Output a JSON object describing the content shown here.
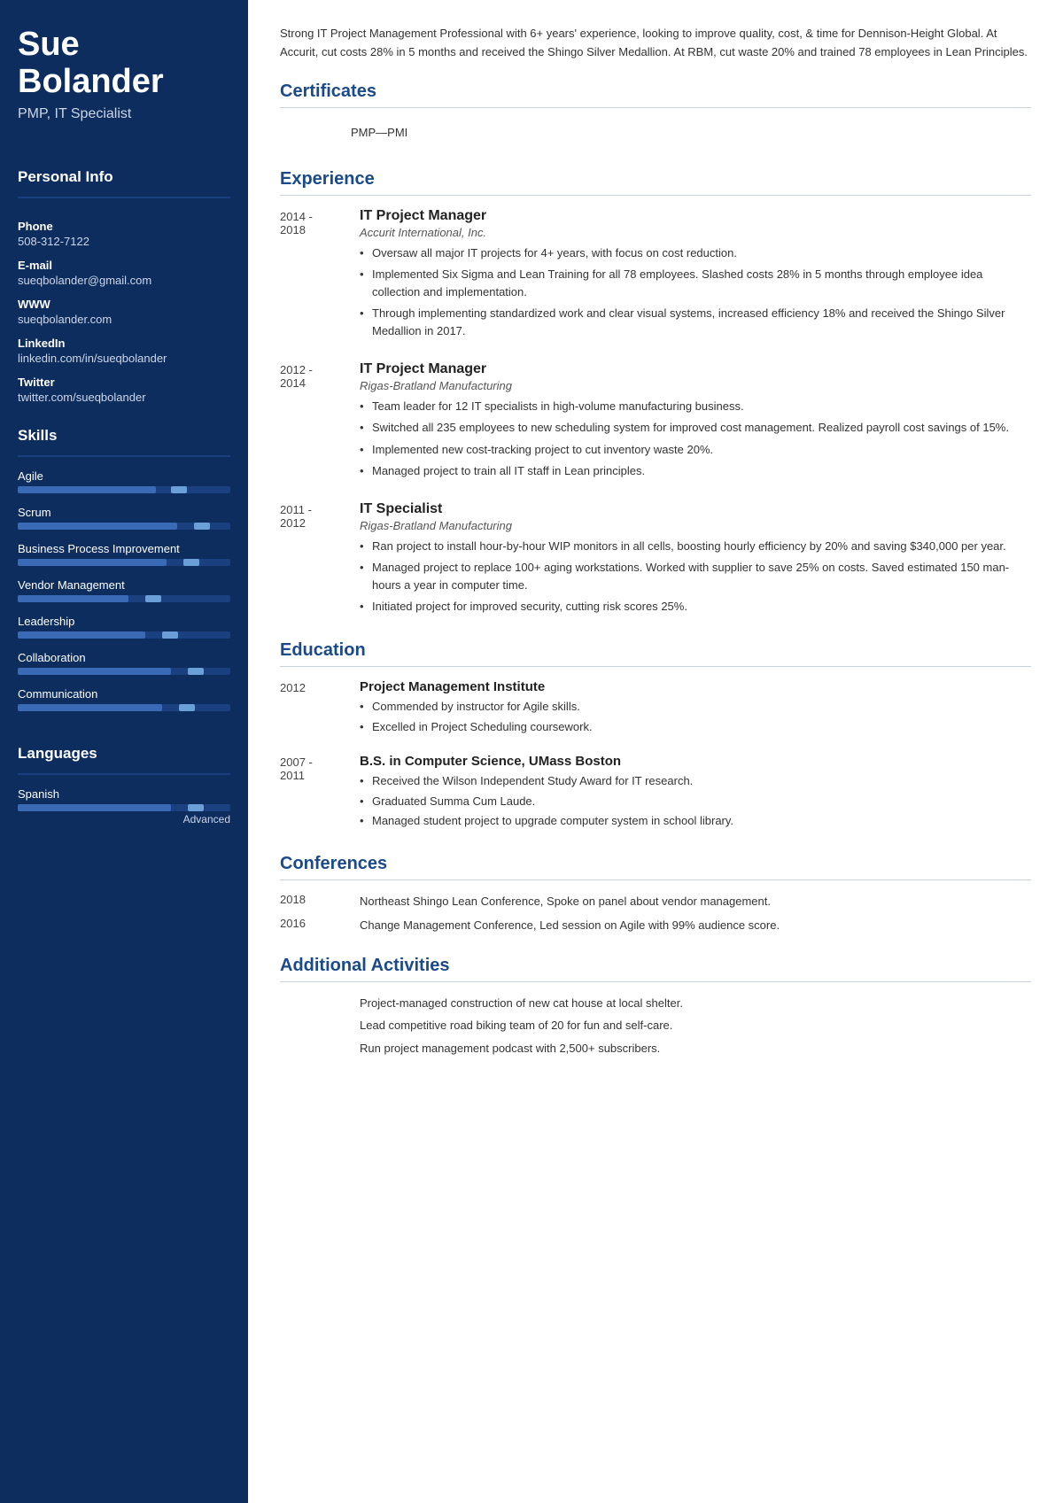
{
  "sidebar": {
    "name": "Sue\nBolander",
    "name_line1": "Sue",
    "name_line2": "Bolander",
    "title": "PMP, IT Specialist",
    "personal_info_label": "Personal Info",
    "phone_label": "Phone",
    "phone": "508-312-7122",
    "email_label": "E-mail",
    "email": "sueqbolander@gmail.com",
    "www_label": "WWW",
    "www": "sueqbolander.com",
    "linkedin_label": "LinkedIn",
    "linkedin": "linkedin.com/in/sueqbolander",
    "twitter_label": "Twitter",
    "twitter": "twitter.com/sueqbolander",
    "skills_label": "Skills",
    "skills": [
      {
        "name": "Agile",
        "fill_pct": 65,
        "dot_pct": 72
      },
      {
        "name": "Scrum",
        "fill_pct": 75,
        "dot_pct": 83
      },
      {
        "name": "Business Process Improvement",
        "fill_pct": 70,
        "dot_pct": 78
      },
      {
        "name": "Vendor Management",
        "fill_pct": 52,
        "dot_pct": 60
      },
      {
        "name": "Leadership",
        "fill_pct": 60,
        "dot_pct": 68
      },
      {
        "name": "Collaboration",
        "fill_pct": 72,
        "dot_pct": 80
      },
      {
        "name": "Communication",
        "fill_pct": 68,
        "dot_pct": 76
      }
    ],
    "languages_label": "Languages",
    "languages": [
      {
        "name": "Spanish",
        "fill_pct": 72,
        "dot_pct": 80,
        "level": "Advanced"
      }
    ]
  },
  "main": {
    "summary": "Strong IT Project Management Professional with 6+ years' experience, looking to improve quality, cost, & time for Dennison-Height Global. At Accurit, cut costs 28% in 5 months and received the Shingo Silver Medallion. At RBM, cut waste 20% and trained 78 employees in Lean Principles.",
    "certificates_label": "Certificates",
    "certificates": [
      {
        "value": "PMP—PMI"
      }
    ],
    "experience_label": "Experience",
    "experience": [
      {
        "dates": "2014 -\n2018",
        "title": "IT Project Manager",
        "company": "Accurit International, Inc.",
        "bullets": [
          "Oversaw all major IT projects for 4+ years, with focus on cost reduction.",
          "Implemented Six Sigma and Lean Training for all 78 employees. Slashed costs 28% in 5 months through employee idea collection and implementation.",
          "Through implementing standardized work and clear visual systems, increased efficiency 18% and received the Shingo Silver Medallion in 2017."
        ]
      },
      {
        "dates": "2012 -\n2014",
        "title": "IT Project Manager",
        "company": "Rigas-Bratland Manufacturing",
        "bullets": [
          "Team leader for 12 IT specialists in high-volume manufacturing business.",
          "Switched all 235 employees to new scheduling system for improved cost management. Realized payroll cost savings of 15%.",
          "Implemented new cost-tracking project to cut inventory waste 20%.",
          "Managed project to train all IT staff in Lean principles."
        ]
      },
      {
        "dates": "2011 -\n2012",
        "title": "IT Specialist",
        "company": "Rigas-Bratland Manufacturing",
        "bullets": [
          "Ran project to install hour-by-hour WIP monitors in all cells, boosting hourly efficiency by 20% and saving $340,000 per year.",
          "Managed project to replace 100+ aging workstations. Worked with supplier to save 25% on costs. Saved estimated 150 man-hours a year in computer time.",
          "Initiated project for improved security, cutting risk scores 25%."
        ]
      }
    ],
    "education_label": "Education",
    "education": [
      {
        "dates": "2012",
        "title": "Project Management Institute",
        "bullets": [
          "Commended by instructor for Agile skills.",
          "Excelled in Project Scheduling coursework."
        ]
      },
      {
        "dates": "2007 -\n2011",
        "title": "B.S. in Computer Science, UMass Boston",
        "bullets": [
          "Received the Wilson Independent Study Award for IT research.",
          "Graduated Summa Cum Laude.",
          "Managed student project to upgrade computer system in school library."
        ]
      }
    ],
    "conferences_label": "Conferences",
    "conferences": [
      {
        "year": "2018",
        "text": "Northeast Shingo Lean Conference, Spoke on panel about vendor management."
      },
      {
        "year": "2016",
        "text": "Change Management Conference, Led session on Agile with 99% audience score."
      }
    ],
    "additional_label": "Additional Activities",
    "additional": [
      "Project-managed construction of new cat house at local shelter.",
      "Lead competitive road biking team of 20 for fun and self-care.",
      "Run project management podcast with 2,500+ subscribers."
    ]
  }
}
